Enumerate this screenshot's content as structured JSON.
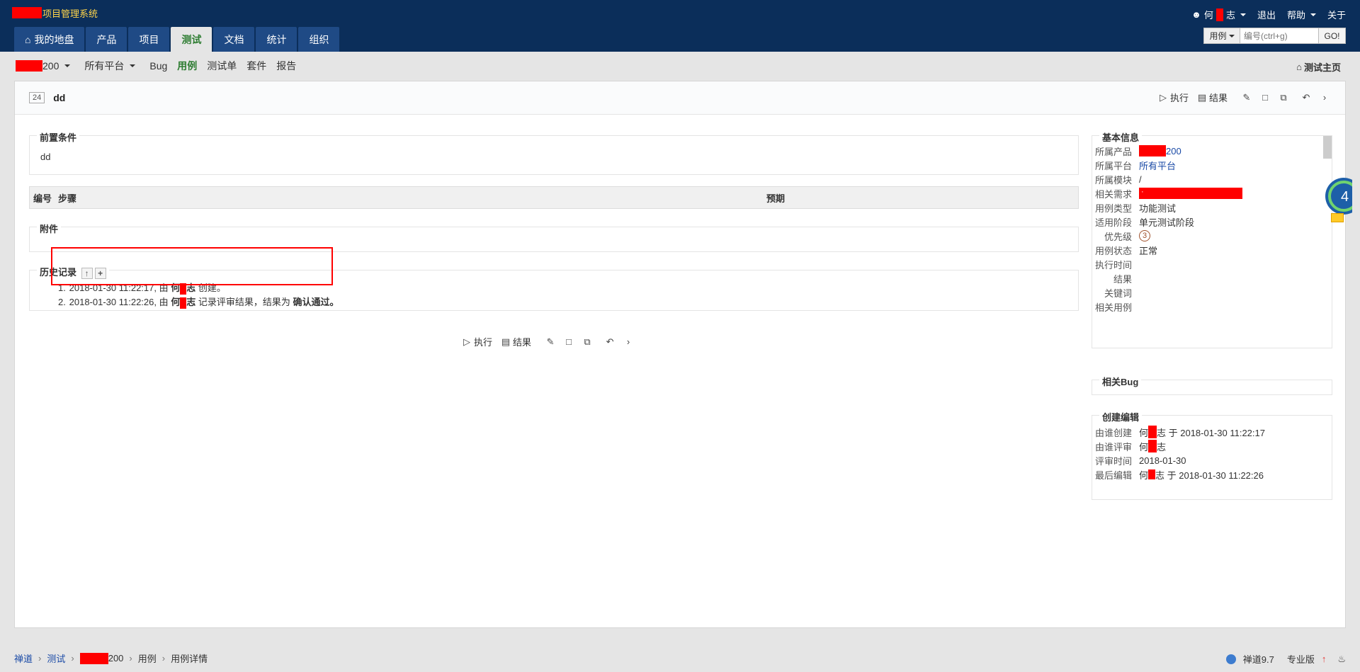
{
  "header": {
    "brand_title": "项目管理系统",
    "user_name_prefix": "何",
    "user_name_suffix": "志",
    "logout": "退出",
    "help": "帮助",
    "about": "关于",
    "tabs": [
      "我的地盘",
      "产品",
      "项目",
      "测试",
      "文档",
      "统计",
      "组织"
    ],
    "active_tab": "测试",
    "search": {
      "type": "用例",
      "placeholder": "编号(ctrl+g)",
      "go": "GO!"
    }
  },
  "subnav": {
    "product_suffix": "200",
    "platform": "所有平台",
    "links": [
      "Bug",
      "用例",
      "测试单",
      "套件",
      "报告"
    ],
    "active": "用例",
    "test_home": "测试主页"
  },
  "case": {
    "id": "24",
    "title": "dd",
    "actions": {
      "run": "执行",
      "result": "结果"
    }
  },
  "main": {
    "precondition_label": "前置条件",
    "precondition_value": "dd",
    "steps_headers": [
      "编号",
      "步骤",
      "预期"
    ],
    "attachment_label": "附件",
    "history_label": "历史记录",
    "history": [
      {
        "num": "1.",
        "text_pre": "2018-01-30 11:22:17, 由 ",
        "user_a": "何",
        "user_b": "志",
        "text_post": " 创建。"
      },
      {
        "num": "2.",
        "text_pre": "2018-01-30 11:22:26, 由 ",
        "user_a": "何",
        "user_b": "志",
        "text_mid": " 记录评审结果，结果为 ",
        "result": "确认通过。"
      }
    ]
  },
  "side": {
    "basic_info_label": "基本信息",
    "basic_info": [
      {
        "key": "所属产品",
        "value": "200"
      },
      {
        "key": "所属平台",
        "value": "所有平台"
      },
      {
        "key": "所属模块",
        "value": "/"
      },
      {
        "key": "相关需求",
        "value": "·"
      },
      {
        "key": "用例类型",
        "value": "功能测试"
      },
      {
        "key": "适用阶段",
        "value": "单元测试阶段"
      },
      {
        "key": "优先级",
        "value": "3"
      },
      {
        "key": "用例状态",
        "value": "正常"
      },
      {
        "key": "执行时间",
        "value": ""
      },
      {
        "key": "结果",
        "value": ""
      },
      {
        "key": "关键词",
        "value": ""
      },
      {
        "key": "相关用例",
        "value": ""
      }
    ],
    "related_bug_label": "相关Bug",
    "create_edit_label": "创建编辑",
    "create_edit": [
      {
        "key": "由谁创建",
        "value_a": "何",
        "value_b": "志 于 2018-01-30 11:22:17"
      },
      {
        "key": "由谁评审",
        "value_a": "何",
        "value_b": "志"
      },
      {
        "key": "评审时间",
        "value_a": "2018-01-30",
        "value_b": ""
      },
      {
        "key": "最后编辑",
        "value_a": "何",
        "value_b": "志 于 2018-01-30 11:22:26"
      }
    ],
    "badge_number": "4"
  },
  "footer": {
    "breadcrumbs": [
      "禅道",
      "测试",
      "200",
      "用例",
      "用例详情"
    ],
    "version": "禅道9.7",
    "edition": "专业版"
  },
  "colors": {
    "header_bg": "#0b2e5a",
    "active_green": "#2e7d32",
    "redaction": "#ff0000",
    "brand_yellow": "#ffd54a"
  }
}
